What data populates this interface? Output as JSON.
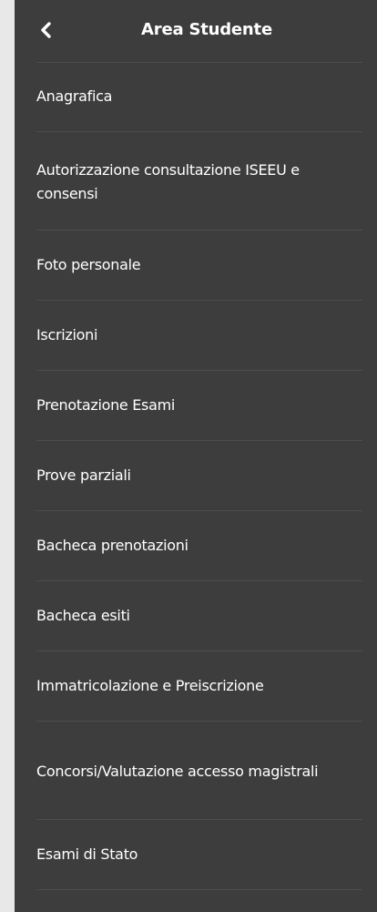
{
  "header": {
    "title": "Area Studente"
  },
  "menu": {
    "items": [
      {
        "label": "Anagrafica"
      },
      {
        "label": "Autorizzazione consultazione ISEEU e consensi"
      },
      {
        "label": "Foto personale"
      },
      {
        "label": "Iscrizioni"
      },
      {
        "label": "Prenotazione Esami"
      },
      {
        "label": "Prove parziali"
      },
      {
        "label": "Bacheca prenotazioni"
      },
      {
        "label": "Bacheca esiti"
      },
      {
        "label": "Immatricolazione e Preiscrizione"
      },
      {
        "label": "Concorsi/Valutazione accesso magistrali"
      },
      {
        "label": "Esami di Stato"
      }
    ]
  },
  "colors": {
    "drawer_bg": "#3d3d3d",
    "divider": "#4d4d4d",
    "text": "#ffffff",
    "page_bg": "#e8e8e8"
  },
  "icons": {
    "back": "chevron-left-icon"
  }
}
